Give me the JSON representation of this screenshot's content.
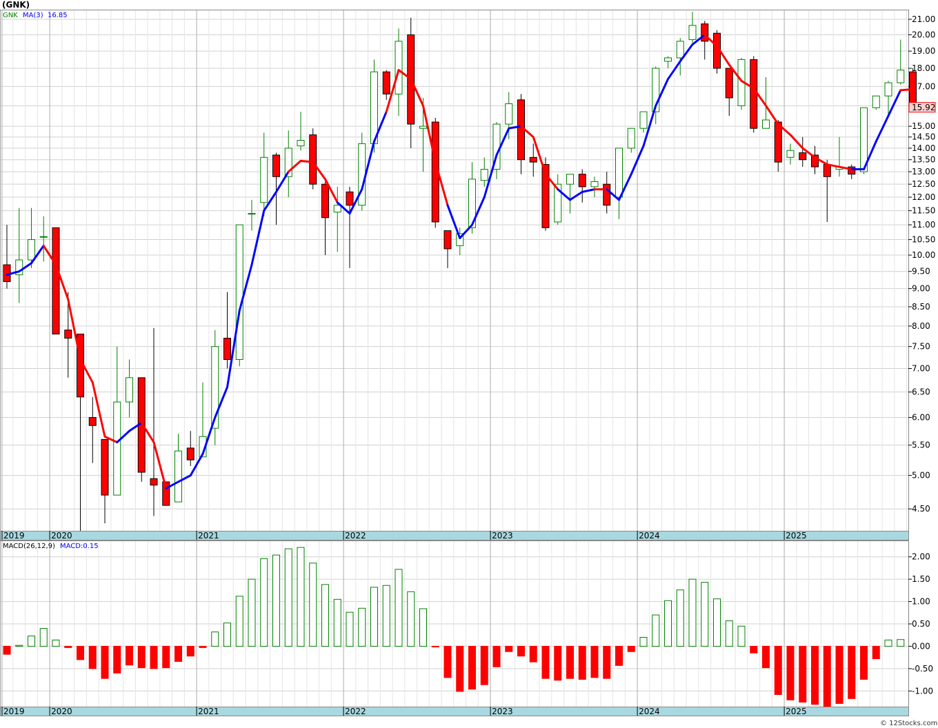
{
  "title": "(GNK)",
  "watermark": "© 12Stocks.com",
  "colors": {
    "up": "#008000",
    "down": "#ff0000",
    "ma_up": "#0000ff",
    "ma_down": "#ff0000",
    "axis_band": "#a8d8e0",
    "grid": "#d0d0d0"
  },
  "chart_data": [
    {
      "type": "candlestick",
      "legend": {
        "symbol": "GNK",
        "ma_label": "MA(3)",
        "ma_value": "16.85"
      },
      "last_price_label": "15.92",
      "y_scale": "log",
      "ylim": [
        4.2,
        21.6
      ],
      "yticks": [
        "4.50",
        "5.00",
        "5.50",
        "6.00",
        "6.50",
        "7.00",
        "7.50",
        "8.00",
        "8.50",
        "9.00",
        "9.50",
        "10.00",
        "10.50",
        "11.00",
        "11.50",
        "12.00",
        "12.50",
        "13.00",
        "13.50",
        "14.00",
        "14.50",
        "15.00",
        "16.00",
        "17.00",
        "18.00",
        "19.00",
        "20.00",
        "21.00"
      ],
      "x_tick_labels": [
        "2019",
        "2020",
        "2021",
        "2022",
        "2023",
        "2024",
        "2025"
      ],
      "candles": [
        [
          9.7,
          11.0,
          9.0,
          9.2
        ],
        [
          9.4,
          11.6,
          8.6,
          9.85
        ],
        [
          9.85,
          11.6,
          9.6,
          10.5
        ],
        [
          10.6,
          11.3,
          9.8,
          10.6
        ],
        [
          10.9,
          10.9,
          7.8,
          7.8
        ],
        [
          7.9,
          8.9,
          6.8,
          7.7
        ],
        [
          7.8,
          7.8,
          4.2,
          6.4
        ],
        [
          6.0,
          6.4,
          5.2,
          5.85
        ],
        [
          5.6,
          5.6,
          4.3,
          4.7
        ],
        [
          4.7,
          7.5,
          4.7,
          6.3
        ],
        [
          6.3,
          7.2,
          6.0,
          6.8
        ],
        [
          6.8,
          6.8,
          4.9,
          5.05
        ],
        [
          4.95,
          7.95,
          4.4,
          4.85
        ],
        [
          4.9,
          4.9,
          4.55,
          4.55
        ],
        [
          4.6,
          5.7,
          4.6,
          5.4
        ],
        [
          5.45,
          5.75,
          5.15,
          5.25
        ],
        [
          5.3,
          6.7,
          5.3,
          5.65
        ],
        [
          5.8,
          7.9,
          5.5,
          7.5
        ],
        [
          7.7,
          8.9,
          7.0,
          7.2
        ],
        [
          7.2,
          11.0,
          7.05,
          11.0
        ],
        [
          11.4,
          11.9,
          10.8,
          11.4
        ],
        [
          11.8,
          14.7,
          11.3,
          13.6
        ],
        [
          13.7,
          13.8,
          11.0,
          12.8
        ],
        [
          12.8,
          14.8,
          12.0,
          14.0
        ],
        [
          14.1,
          15.7,
          13.9,
          14.35
        ],
        [
          14.6,
          14.9,
          12.3,
          12.5
        ],
        [
          12.5,
          12.6,
          10.0,
          11.25
        ],
        [
          11.45,
          12.4,
          10.1,
          11.7
        ],
        [
          12.2,
          12.4,
          9.6,
          11.7
        ],
        [
          11.7,
          14.7,
          11.5,
          14.2
        ],
        [
          14.2,
          18.5,
          13.8,
          17.8
        ],
        [
          17.8,
          17.9,
          16.3,
          16.6
        ],
        [
          16.6,
          20.4,
          15.5,
          19.6
        ],
        [
          20.0,
          21.1,
          14.0,
          15.1
        ],
        [
          14.9,
          16.4,
          13.0,
          15.0
        ],
        [
          15.2,
          15.4,
          10.9,
          11.1
        ],
        [
          10.8,
          10.8,
          9.6,
          10.2
        ],
        [
          10.3,
          10.9,
          10.0,
          10.7
        ],
        [
          10.9,
          13.4,
          10.7,
          12.7
        ],
        [
          12.65,
          13.6,
          12.4,
          13.1
        ],
        [
          13.1,
          15.2,
          12.7,
          15.1
        ],
        [
          15.1,
          16.7,
          14.4,
          16.1
        ],
        [
          16.3,
          16.6,
          12.9,
          13.5
        ],
        [
          13.6,
          14.2,
          12.8,
          13.4
        ],
        [
          13.3,
          13.6,
          10.8,
          10.9
        ],
        [
          11.1,
          12.9,
          11.0,
          12.5
        ],
        [
          12.5,
          12.8,
          11.4,
          12.9
        ],
        [
          12.9,
          13.1,
          11.8,
          12.4
        ],
        [
          12.4,
          12.8,
          12.0,
          12.6
        ],
        [
          12.5,
          13.0,
          11.4,
          11.7
        ],
        [
          12.0,
          14.0,
          11.2,
          14.0
        ],
        [
          14.0,
          14.6,
          13.8,
          14.9
        ],
        [
          14.9,
          15.7,
          14.7,
          15.7
        ],
        [
          15.7,
          18.1,
          15.1,
          18.0
        ],
        [
          18.4,
          18.7,
          18.0,
          18.6
        ],
        [
          18.6,
          19.8,
          17.6,
          19.6
        ],
        [
          19.7,
          21.5,
          19.5,
          20.6
        ],
        [
          20.7,
          20.9,
          18.5,
          19.6
        ],
        [
          20.1,
          20.3,
          17.7,
          18.0
        ],
        [
          18.0,
          18.0,
          15.5,
          16.4
        ],
        [
          16.0,
          18.6,
          15.8,
          18.5
        ],
        [
          18.5,
          18.7,
          14.7,
          14.9
        ],
        [
          14.9,
          17.5,
          14.9,
          15.3
        ],
        [
          15.2,
          15.3,
          13.0,
          13.4
        ],
        [
          13.6,
          14.2,
          13.3,
          13.9
        ],
        [
          13.8,
          14.5,
          13.2,
          13.5
        ],
        [
          13.7,
          14.1,
          12.9,
          13.2
        ],
        [
          13.3,
          13.5,
          11.1,
          12.8
        ],
        [
          13.1,
          14.5,
          12.8,
          13.2
        ],
        [
          13.2,
          13.3,
          12.7,
          12.9
        ],
        [
          13.0,
          15.9,
          12.9,
          15.9
        ],
        [
          15.9,
          16.5,
          15.8,
          16.5
        ],
        [
          16.5,
          17.3,
          15.4,
          17.2
        ],
        [
          17.2,
          19.7,
          17.1,
          17.9
        ],
        [
          17.8,
          18.0,
          15.9,
          15.92
        ]
      ],
      "ma3": [
        9.4,
        9.5,
        9.75,
        10.3,
        9.7,
        8.7,
        7.2,
        6.7,
        5.65,
        5.55,
        5.75,
        5.9,
        5.55,
        4.8,
        4.9,
        5.0,
        5.35,
        6.0,
        6.6,
        8.4,
        9.7,
        11.5,
        12.2,
        13.0,
        13.45,
        13.4,
        12.7,
        11.8,
        11.4,
        12.3,
        14.3,
        15.7,
        17.9,
        17.4,
        16.0,
        13.4,
        11.7,
        10.55,
        11.0,
        12.0,
        13.7,
        14.9,
        15.0,
        14.5,
        12.9,
        12.3,
        11.9,
        12.2,
        12.3,
        12.3,
        11.9,
        12.9,
        14.1,
        16.0,
        17.4,
        18.4,
        19.4,
        20.0,
        19.3,
        18.2,
        17.3,
        16.9,
        16.0,
        15.1,
        14.6,
        14.0,
        13.6,
        13.3,
        13.2,
        13.1,
        13.1,
        14.3,
        15.5,
        16.8,
        16.85
      ],
      "ma3_colors": [
        "u",
        "u",
        "u",
        "u",
        "d",
        "d",
        "d",
        "d",
        "d",
        "d",
        "u",
        "u",
        "d",
        "d",
        "u",
        "u",
        "u",
        "u",
        "u",
        "u",
        "u",
        "u",
        "u",
        "u",
        "d",
        "d",
        "d",
        "d",
        "u",
        "u",
        "u",
        "u",
        "d",
        "d",
        "d",
        "d",
        "d",
        "u",
        "u",
        "u",
        "u",
        "u",
        "u",
        "d",
        "d",
        "d",
        "u",
        "u",
        "u",
        "d",
        "u",
        "u",
        "u",
        "u",
        "u",
        "u",
        "u",
        "u",
        "d",
        "d",
        "d",
        "d",
        "d",
        "d",
        "d",
        "d",
        "d",
        "d",
        "d",
        "d",
        "u",
        "u",
        "u",
        "u",
        "d"
      ]
    },
    {
      "type": "bar",
      "legend": {
        "indicator": "MACD(26,12,9)",
        "value_label": "MACD:0.15"
      },
      "ylim": [
        -1.35,
        2.35
      ],
      "yticks": [
        "2.00",
        "1.50",
        "1.00",
        "0.50",
        "0.00",
        "-0.50",
        "-1.00"
      ],
      "x_tick_labels": [
        "2019",
        "2020",
        "2021",
        "2022",
        "2023",
        "2024",
        "2025"
      ],
      "values": [
        -0.18,
        0.02,
        0.23,
        0.4,
        0.14,
        -0.03,
        -0.3,
        -0.5,
        -0.72,
        -0.6,
        -0.42,
        -0.48,
        -0.5,
        -0.48,
        -0.34,
        -0.22,
        -0.03,
        0.32,
        0.52,
        1.12,
        1.5,
        1.96,
        2.04,
        2.18,
        2.21,
        1.86,
        1.38,
        1.05,
        0.76,
        0.85,
        1.32,
        1.36,
        1.72,
        1.22,
        0.84,
        -0.01,
        -0.7,
        -1.01,
        -0.96,
        -0.86,
        -0.46,
        -0.12,
        -0.22,
        -0.35,
        -0.72,
        -0.76,
        -0.72,
        -0.74,
        -0.7,
        -0.72,
        -0.43,
        -0.12,
        0.2,
        0.7,
        1.02,
        1.26,
        1.5,
        1.43,
        1.06,
        0.57,
        0.45,
        -0.15,
        -0.48,
        -1.08,
        -1.2,
        -1.25,
        -1.3,
        -1.35,
        -1.28,
        -1.17,
        -0.74,
        -0.28,
        0.14,
        0.15
      ]
    }
  ]
}
